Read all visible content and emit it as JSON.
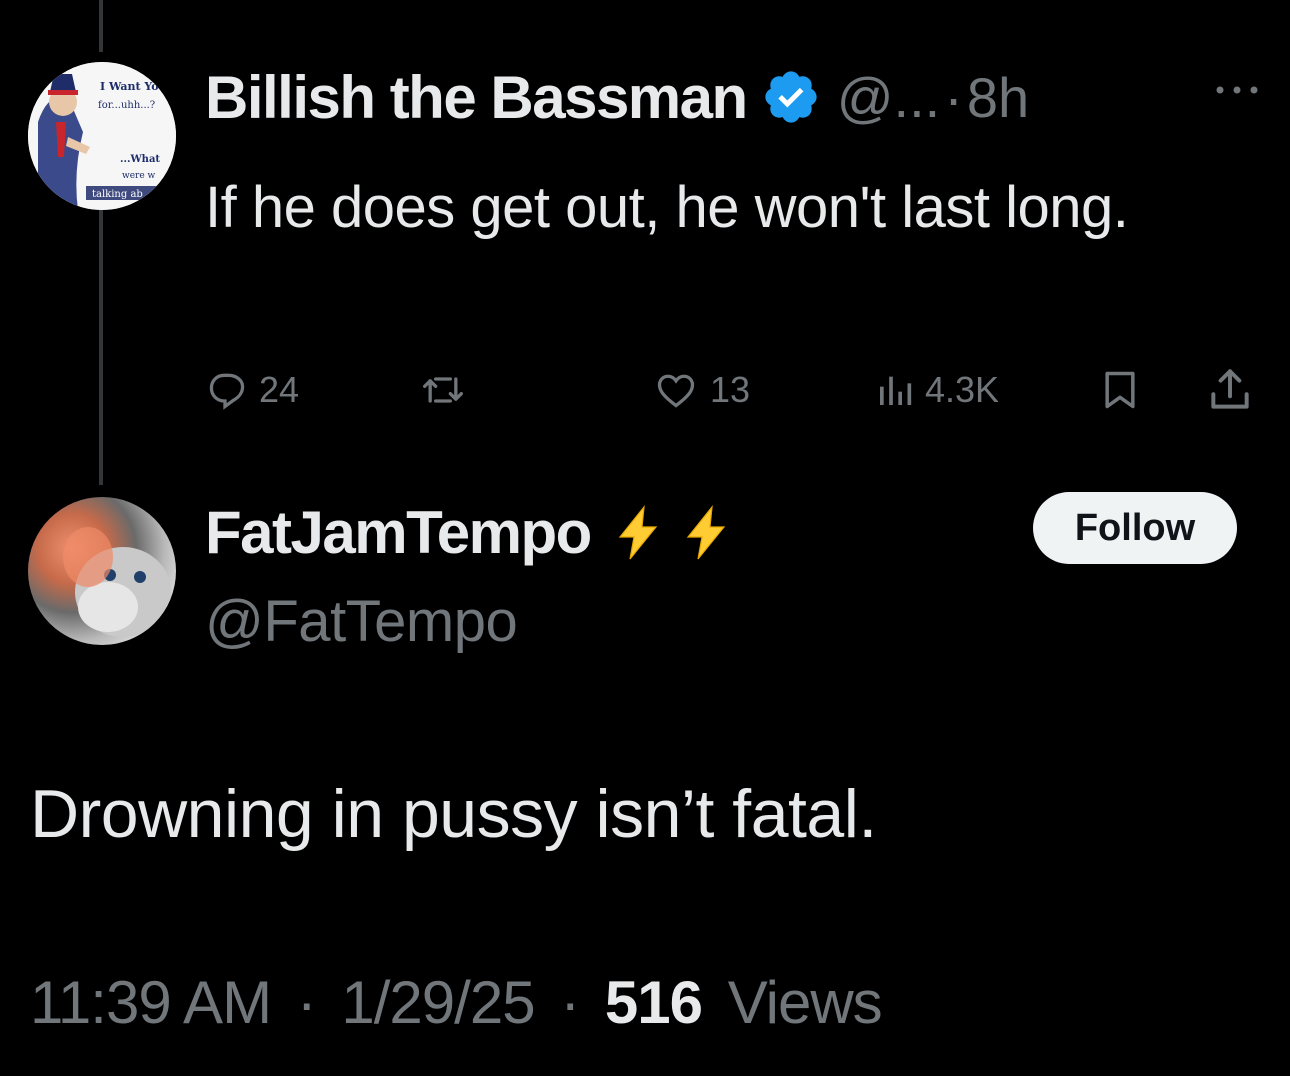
{
  "parent_tweet": {
    "author_name": "Billish the Bassman",
    "handle": "@...",
    "separator": "·",
    "time": "8h",
    "text": "If he does get out, he won't last long.",
    "avatar_text": [
      "I Want Yo",
      "for...uhh...?",
      "...What",
      "were w",
      "talking ab"
    ],
    "actions": {
      "replies": "24",
      "retweets": "",
      "likes": "13",
      "views": "4.3K"
    }
  },
  "reply_tweet": {
    "author_name": "FatJamTempo",
    "handle": "@FatTempo",
    "follow_label": "Follow",
    "text": "Drowning in pussy isn’t fatal.",
    "time": "11:39 AM",
    "separator": "·",
    "date": "1/29/25",
    "views_count": "516",
    "views_label": "Views"
  },
  "colors": {
    "background": "#000000",
    "primary_text": "#e7e9ea",
    "secondary_text": "#71767b",
    "verified_blue": "#1d9bf0",
    "bolt_yellow": "#ffcc33"
  }
}
